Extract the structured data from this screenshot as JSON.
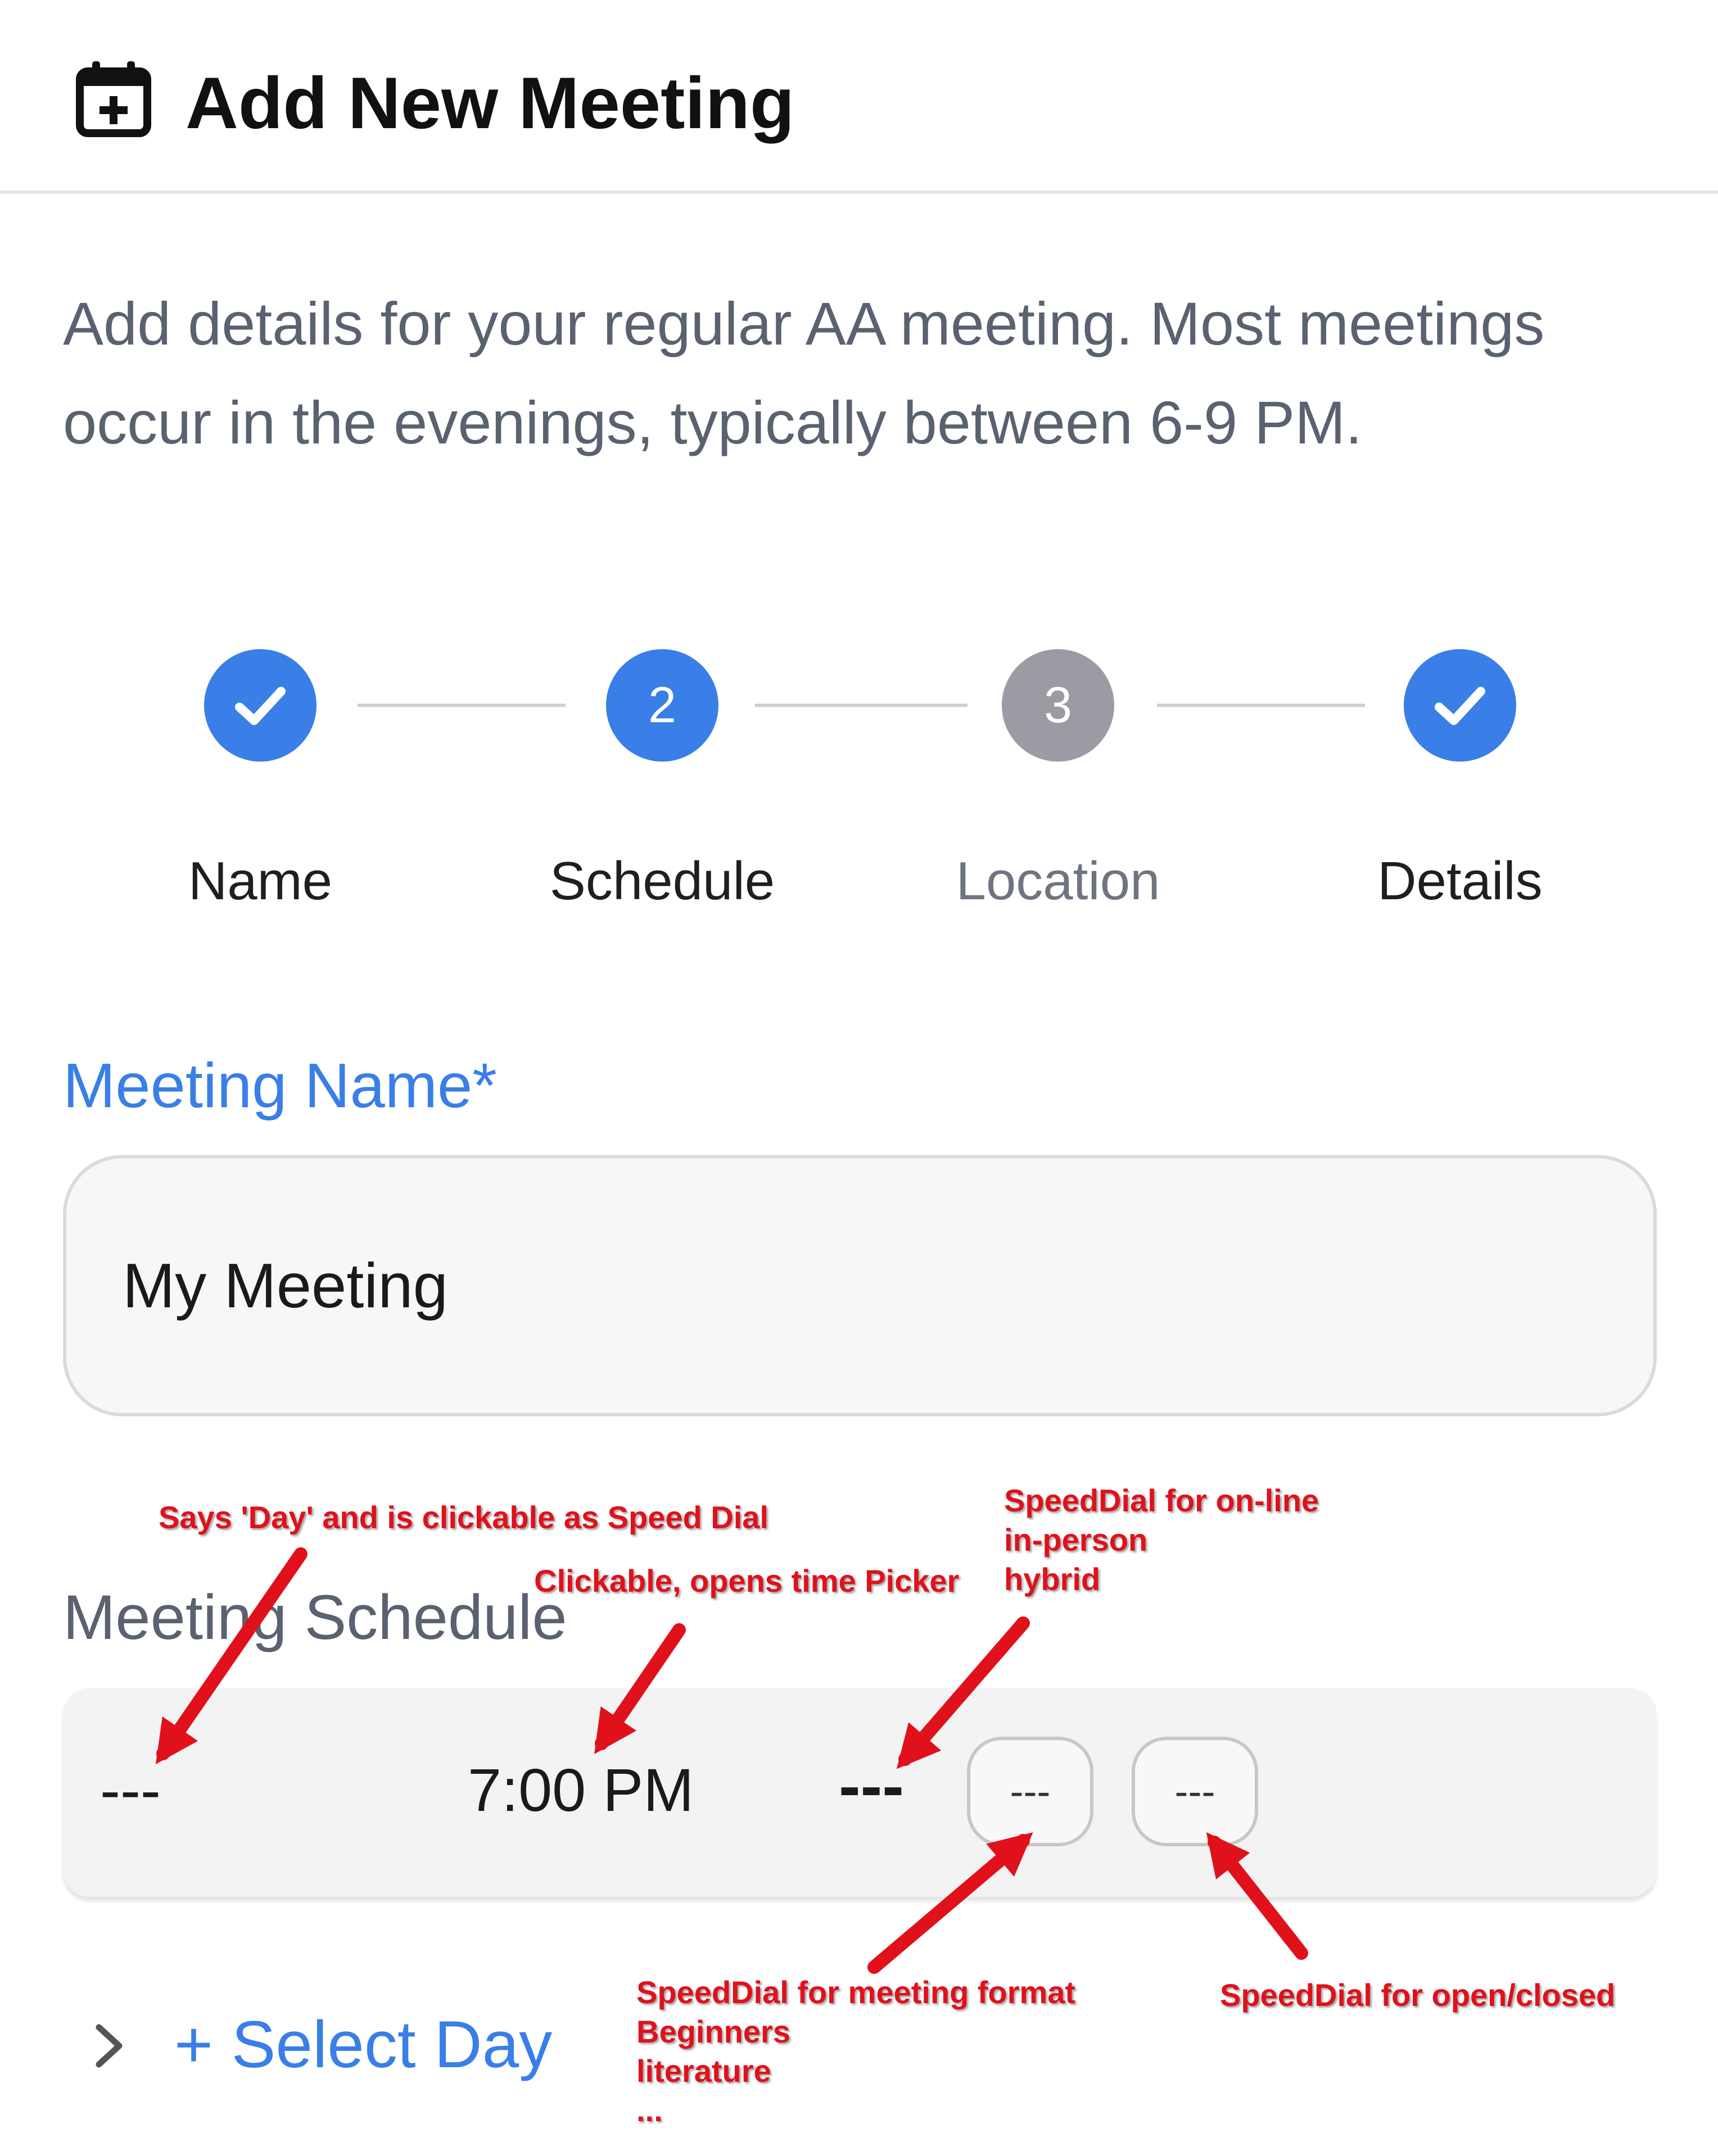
{
  "header": {
    "title": "Add New Meeting",
    "icon": "calendar-plus-icon"
  },
  "description": "Add details for your regular AA meeting. Most meetings occur in the evenings, typically between 6-9 PM.",
  "stepper": {
    "steps": [
      {
        "label": "Name",
        "state": "complete",
        "number": ""
      },
      {
        "label": "Schedule",
        "state": "active",
        "number": "2"
      },
      {
        "label": "Location",
        "state": "pending",
        "number": "3"
      },
      {
        "label": "Details",
        "state": "complete",
        "number": ""
      }
    ]
  },
  "meeting_name": {
    "label": "Meeting Name*",
    "value": "My Meeting"
  },
  "schedule": {
    "title": "Meeting Schedule",
    "day": "---",
    "time": "7:00 PM",
    "mode": "---",
    "format": "---",
    "open_closed": "---",
    "select_day_label": "+ Select Day"
  },
  "annotations": {
    "day": "Says 'Day' and is clickable as Speed Dial",
    "time": "Clickable, opens time Picker",
    "mode_line1": "SpeedDial for on-line",
    "mode_line2": "in-person",
    "mode_line3": "hybrid",
    "format_line1": "SpeedDial for meeting format",
    "format_line2": "Beginners",
    "format_line3": "literature",
    "format_line4": "...",
    "open_closed": "SpeedDial for open/closed"
  },
  "colors": {
    "accent": "#3a7ee8",
    "pending": "#9b9ca3",
    "annotation": "#e0111b"
  }
}
